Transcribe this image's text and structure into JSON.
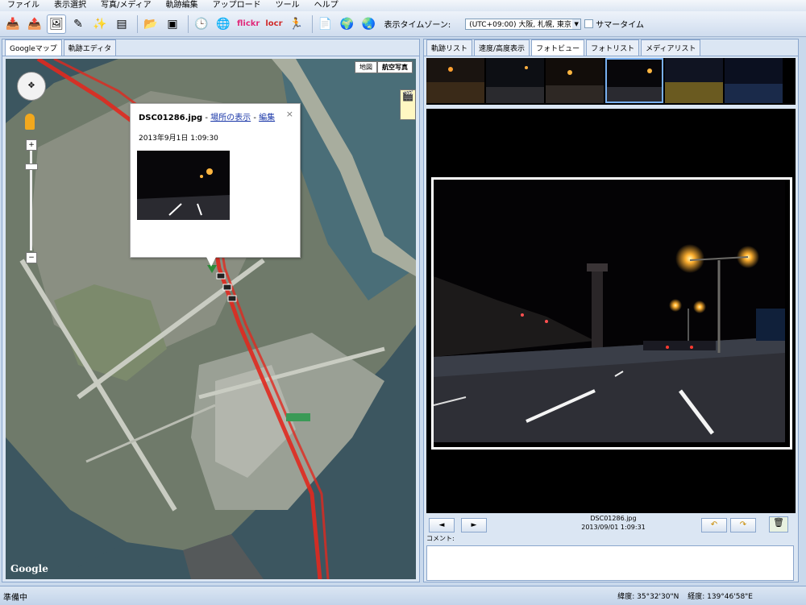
{
  "menu": [
    "ファイル",
    "表示選択",
    "写真/メディア",
    "軌跡編集",
    "アップロード",
    "ツール",
    "ヘルプ"
  ],
  "toolbar": {
    "icons": [
      "import-icon",
      "export-icon",
      "photo-icon",
      "edit-icon",
      "wand-icon",
      "layers-icon",
      "folder-icon",
      "image-icon",
      "clock-icon",
      "globe-icon",
      "flickr-icon",
      "locr-icon",
      "runner-icon",
      "document-icon",
      "google-earth-icon",
      "earth-icon"
    ],
    "flickr_label": "flickr",
    "locr_label": "locr",
    "timezone_label": "表示タイムゾーン:",
    "timezone_value": "(UTC+09:00) 大阪, 札幌, 東京",
    "summer_label": "サマータイム"
  },
  "left_tabs": [
    {
      "label": "Googleマップ",
      "active": true
    },
    {
      "label": "軌跡エディタ",
      "active": false
    }
  ],
  "map": {
    "type_buttons": [
      {
        "label": "地図",
        "active": false
      },
      {
        "label": "航空写真",
        "active": true
      }
    ],
    "popup": {
      "filename": "DSC01286.jpg",
      "separator": " - ",
      "link1": "場所の表示",
      "link2": "編集",
      "date": "2013年9月1日 1:09:30",
      "close": "×"
    },
    "google_logo": "Google"
  },
  "right_tabs": [
    {
      "label": "軌跡リスト",
      "active": false
    },
    {
      "label": "速度/高度表示",
      "active": false
    },
    {
      "label": "フォトビュー",
      "active": true
    },
    {
      "label": "フォトリスト",
      "active": false
    },
    {
      "label": "メディアリスト",
      "active": false
    }
  ],
  "photo_view": {
    "filename": "DSC01286.jpg",
    "datetime": "2013/09/01 1:09:31",
    "prev": "◄",
    "next": "►",
    "comment_label": "コメント:"
  },
  "status": {
    "left": "準備中",
    "latitude": "緯度: 35°32'30\"N",
    "longitude": "経度: 139°46'58\"E"
  },
  "colors": {
    "accent": "#8aa6cc",
    "track": "#e0291f",
    "panel": "#dbe6f3"
  }
}
